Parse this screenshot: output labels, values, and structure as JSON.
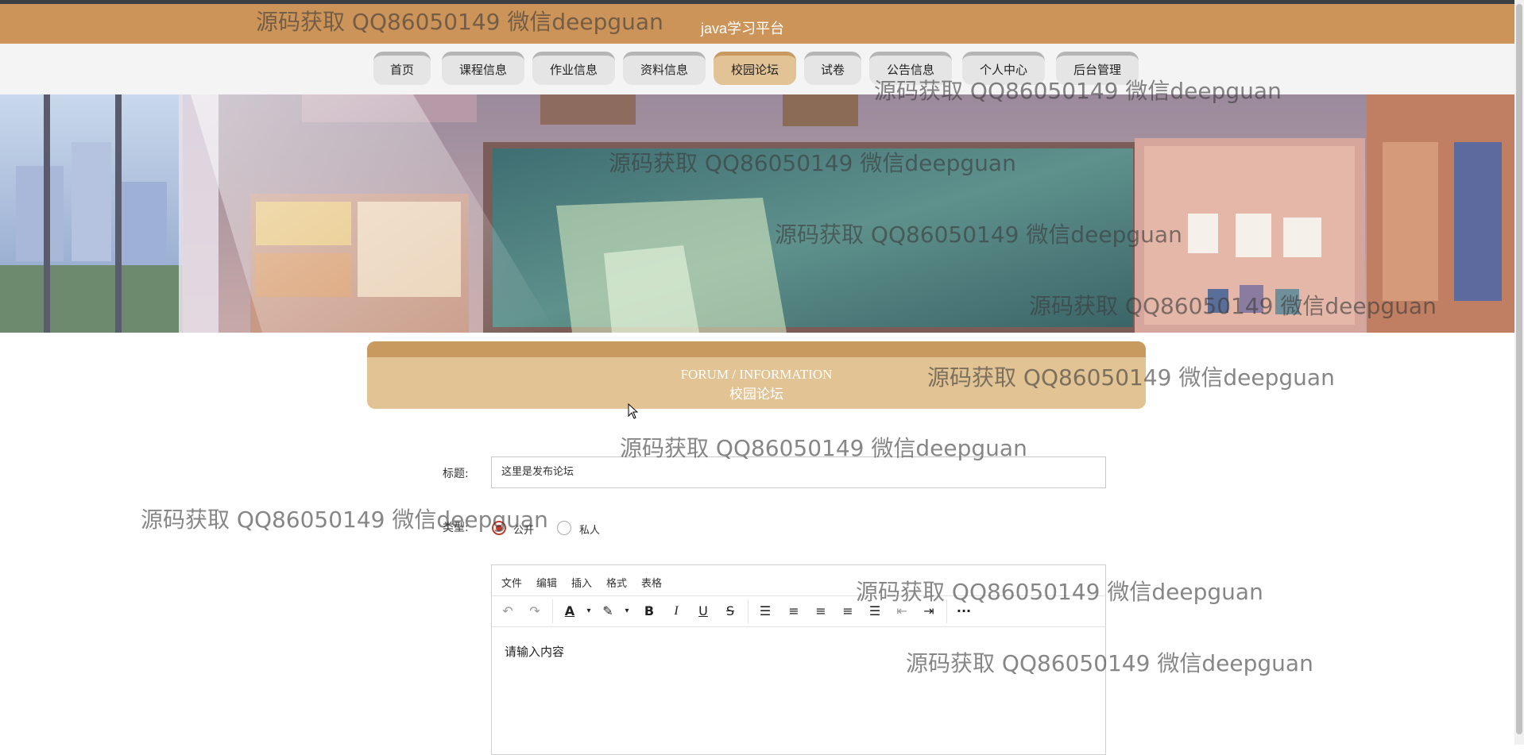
{
  "header": {
    "site_title": "java学习平台"
  },
  "nav": {
    "items": [
      {
        "label": "首页",
        "active": false
      },
      {
        "label": "课程信息",
        "active": false
      },
      {
        "label": "作业信息",
        "active": false
      },
      {
        "label": "资料信息",
        "active": false
      },
      {
        "label": "校园论坛",
        "active": true
      },
      {
        "label": "试卷",
        "active": false
      },
      {
        "label": "公告信息",
        "active": false
      },
      {
        "label": "个人中心",
        "active": false
      },
      {
        "label": "后台管理",
        "active": false
      }
    ]
  },
  "section": {
    "title_en": "FORUM / INFORMATION",
    "title_zh": "校园论坛"
  },
  "form": {
    "title_label": "标题:",
    "title_value": "这里是发布论坛",
    "type_label": "类型:",
    "type_options": [
      {
        "label": "公开",
        "checked": true
      },
      {
        "label": "私人",
        "checked": false
      }
    ]
  },
  "editor": {
    "menus": [
      "文件",
      "编辑",
      "插入",
      "格式",
      "表格"
    ],
    "placeholder": "请输入内容",
    "tools": [
      "undo-icon",
      "redo-icon",
      "font-color-icon",
      "highlight-icon",
      "bold-icon",
      "italic-icon",
      "underline-icon",
      "strikethrough-icon",
      "list-icon",
      "align-left-icon",
      "align-center-icon",
      "align-right-icon",
      "justify-icon",
      "outdent-icon",
      "indent-icon",
      "more-icon"
    ]
  },
  "watermark": {
    "text": "源码获取 QQ86050149 微信deepguan"
  },
  "colors": {
    "header": "#cd9459",
    "active_tab": "#e1c396",
    "section_bar": "#e1c394",
    "radio_checked": "#c0392b"
  }
}
